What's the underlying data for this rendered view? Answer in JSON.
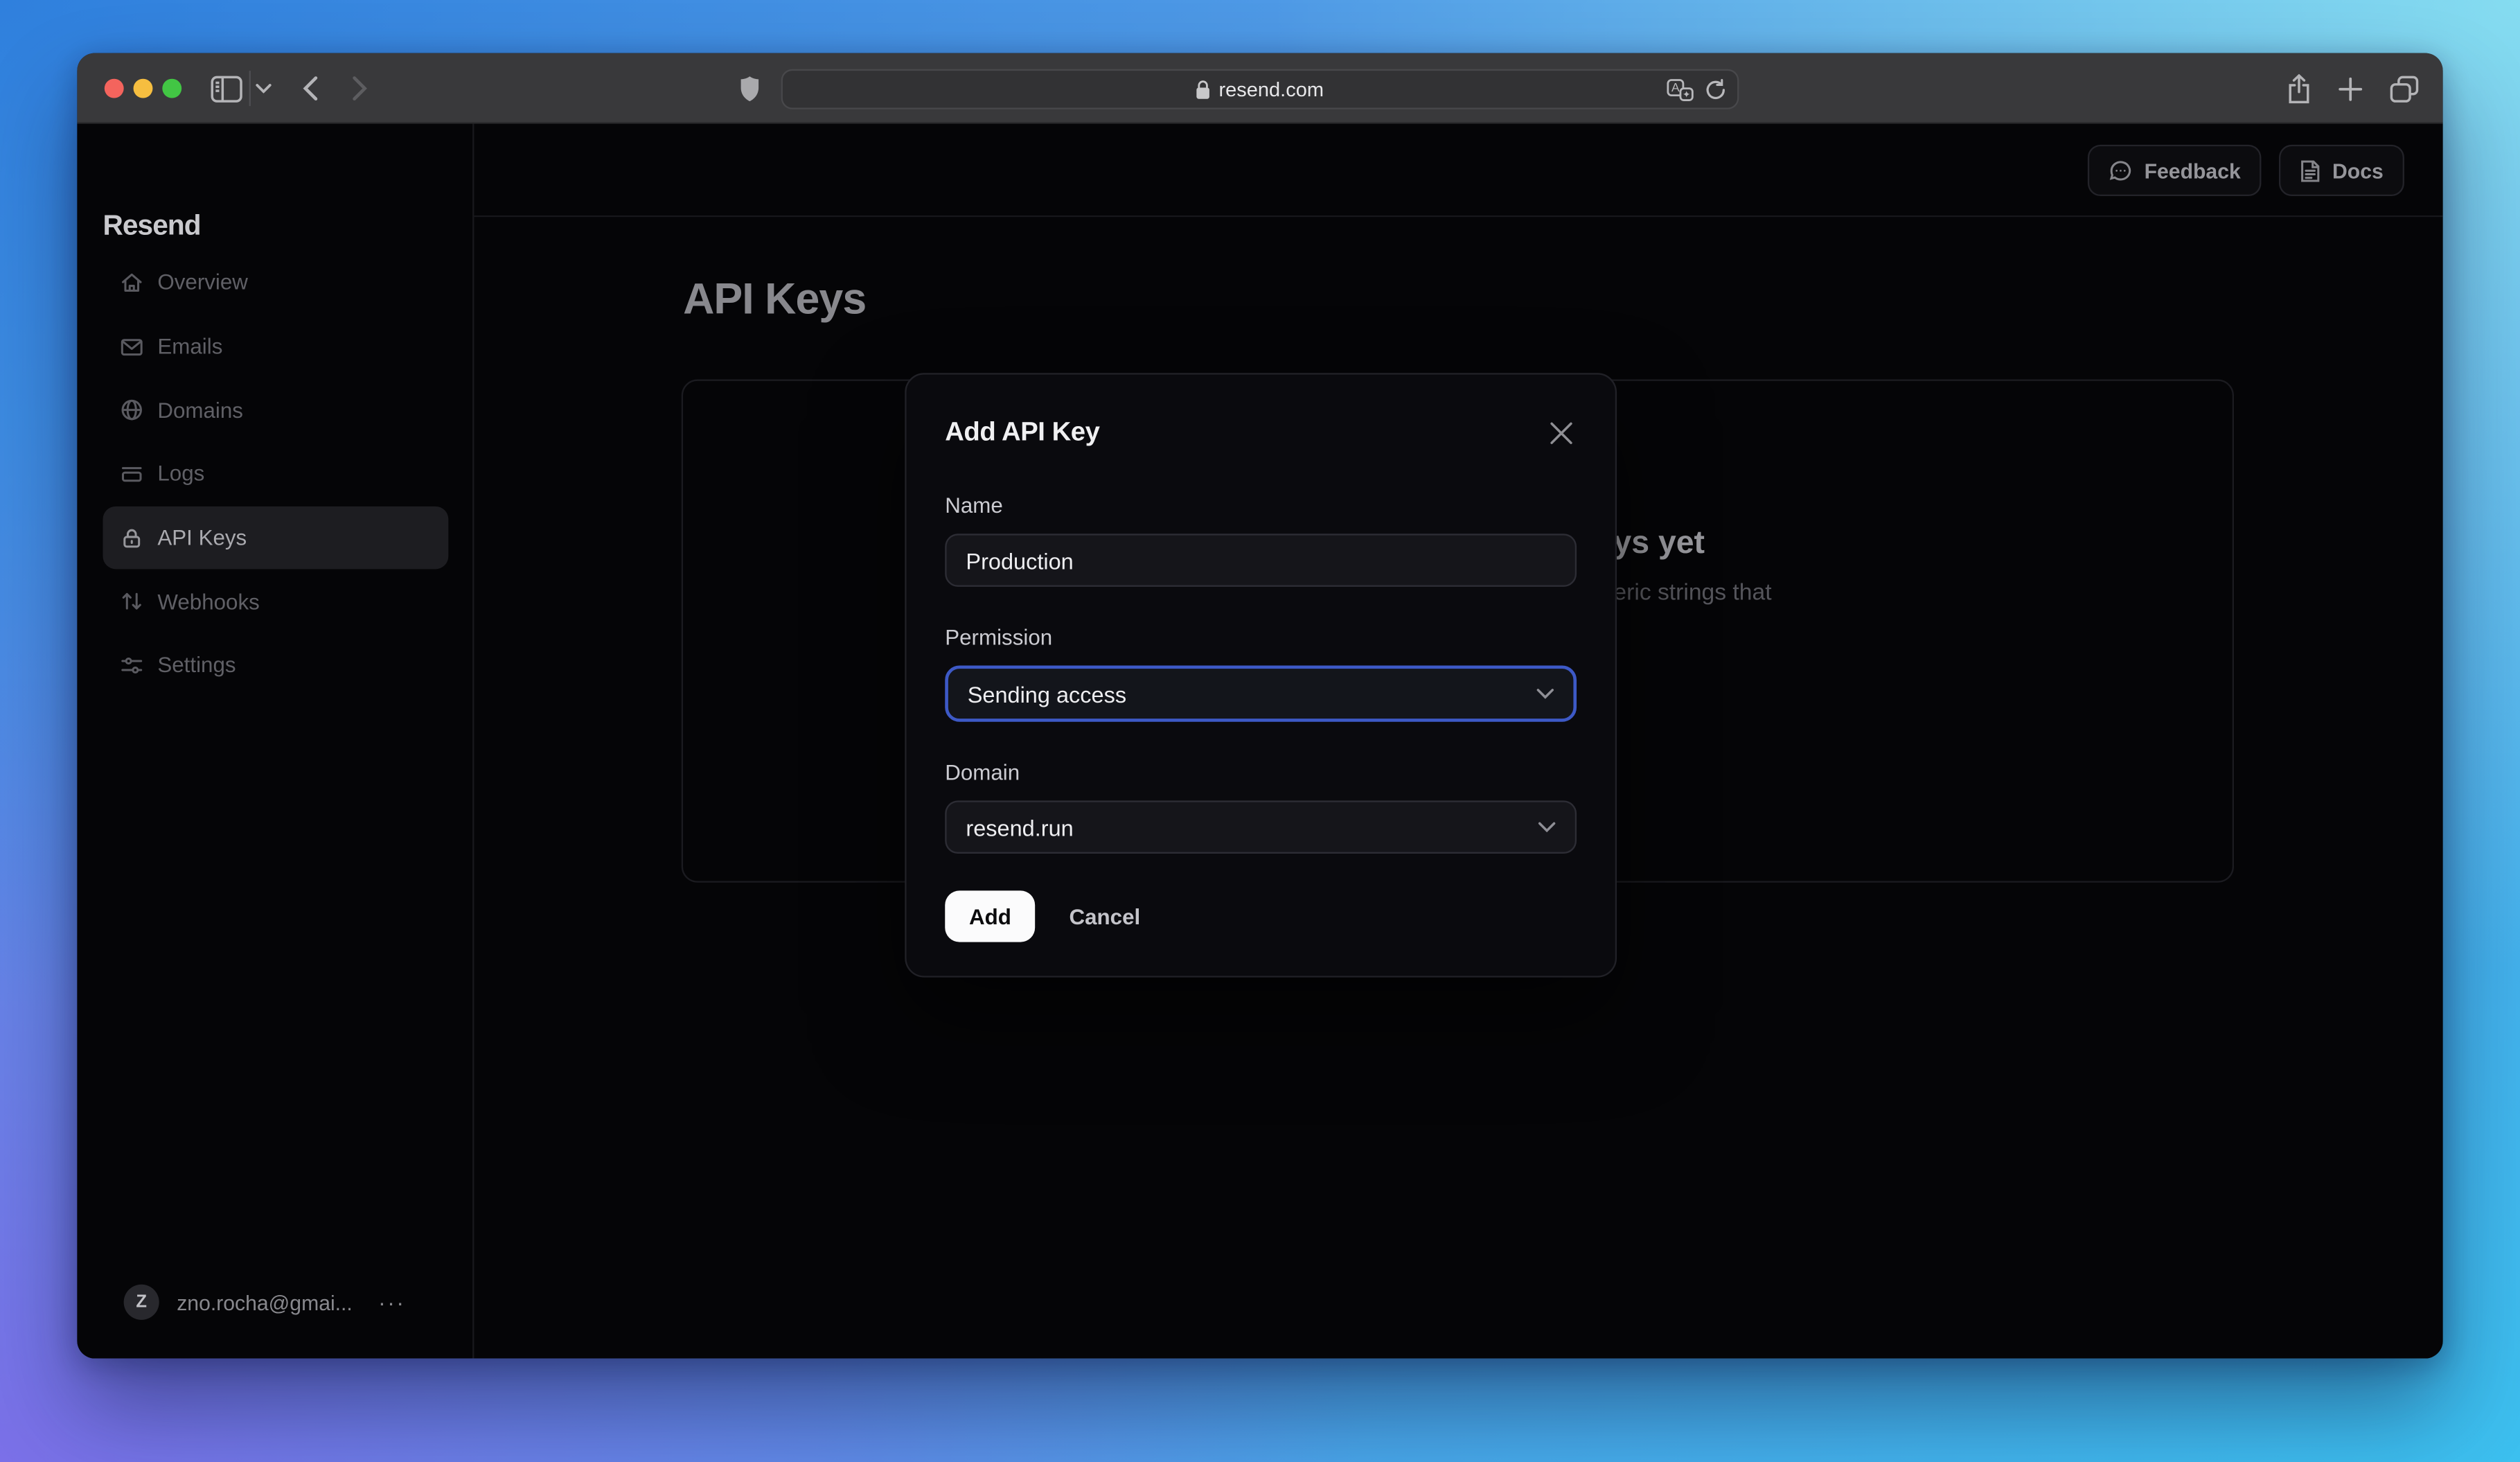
{
  "browser": {
    "url": "resend.com",
    "window_controls": {
      "close": "red",
      "minimize": "yellow",
      "zoom": "green"
    },
    "traffic_colors": {
      "red": "#f4645d",
      "yellow": "#f6be40",
      "green": "#42c644"
    }
  },
  "sidebar": {
    "logo": "Resend",
    "items": [
      {
        "label": "Overview",
        "icon": "home-icon",
        "active": false
      },
      {
        "label": "Emails",
        "icon": "mail-icon",
        "active": false
      },
      {
        "label": "Domains",
        "icon": "globe-icon",
        "active": false
      },
      {
        "label": "Logs",
        "icon": "logs-icon",
        "active": false
      },
      {
        "label": "API Keys",
        "icon": "lock-icon",
        "active": true
      },
      {
        "label": "Webhooks",
        "icon": "webhooks-icon",
        "active": false
      },
      {
        "label": "Settings",
        "icon": "sliders-icon",
        "active": false
      }
    ],
    "account": {
      "avatar_initial": "Z",
      "email": "zno.rocha@gmai...",
      "menu_label": "···"
    }
  },
  "header": {
    "feedback_label": "Feedback",
    "docs_label": "Docs"
  },
  "main": {
    "title": "API Keys",
    "empty_state": {
      "title_fragment": "ys yet",
      "description_fragment": "eric strings that"
    }
  },
  "modal": {
    "title": "Add API Key",
    "fields": [
      {
        "label": "Name",
        "type": "input",
        "value": "Production"
      },
      {
        "label": "Permission",
        "type": "select",
        "value": "Sending access",
        "focused": true
      },
      {
        "label": "Domain",
        "type": "select",
        "value": "resend.run",
        "focused": false
      }
    ],
    "add_label": "Add",
    "cancel_label": "Cancel"
  },
  "colors": {
    "accent_focus_blue": "#3d59c6",
    "gradient_top_left": "#2f80dd",
    "gradient_top_right": "#85dcf0",
    "gradient_bottom_left": "#7b70e8",
    "gradient_bottom_right": "#3cc0ef",
    "toolbar": "#39393b",
    "app_background": "#050507",
    "modal_background": "#0a0a0e"
  }
}
